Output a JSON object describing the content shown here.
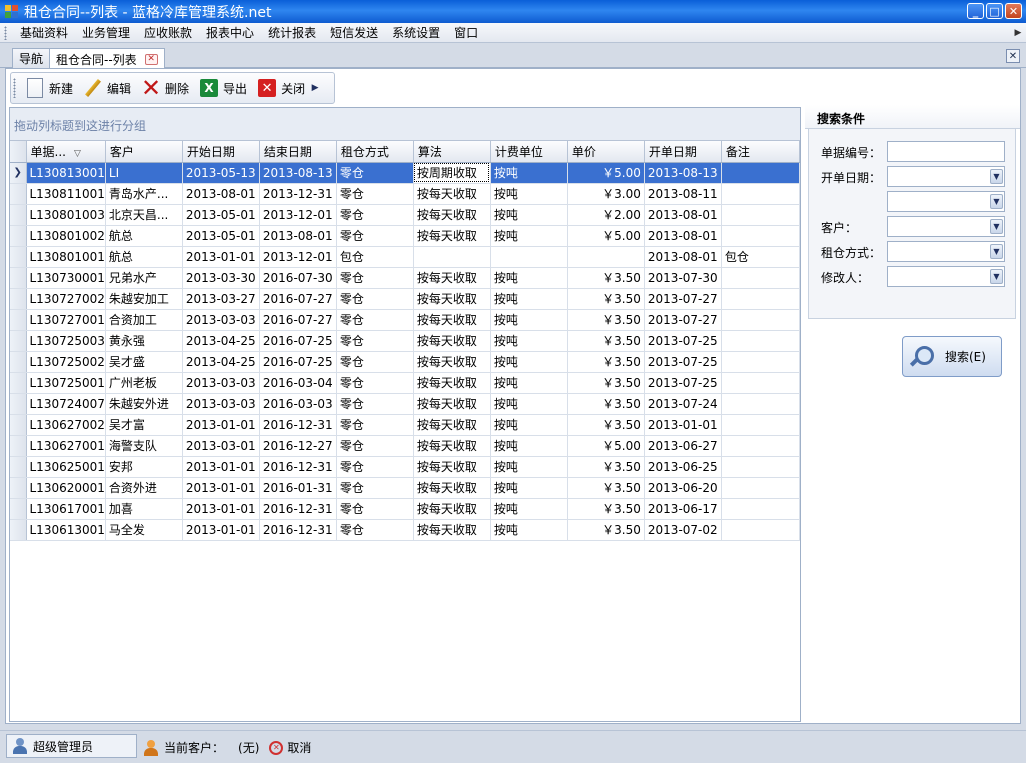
{
  "window": {
    "title": "租仓合同--列表 - 蓝格冷库管理系统.net"
  },
  "menu": [
    "基础资料",
    "业务管理",
    "应收账款",
    "报表中心",
    "统计报表",
    "短信发送",
    "系统设置",
    "窗口"
  ],
  "tabs": [
    {
      "label": "导航"
    },
    {
      "label": "租仓合同--列表"
    }
  ],
  "toolbar": {
    "new": "新建",
    "edit": "编辑",
    "delete": "删除",
    "export": "导出",
    "close": "关闭"
  },
  "grid": {
    "group_hint": "拖动列标题到这进行分组",
    "columns": [
      "单据...",
      "客户",
      "开始日期",
      "结束日期",
      "租仓方式",
      "算法",
      "计费单位",
      "单价",
      "开单日期",
      "备注"
    ],
    "rows": [
      [
        "L130813001",
        "LI",
        "2013-05-13",
        "2013-08-13",
        "零仓",
        "按周期收取",
        "按吨",
        "￥5.00",
        "2013-08-13",
        ""
      ],
      [
        "L130811001",
        "青岛水产...",
        "2013-08-01",
        "2013-12-31",
        "零仓",
        "按每天收取",
        "按吨",
        "￥3.00",
        "2013-08-11",
        ""
      ],
      [
        "L130801003",
        "北京天昌...",
        "2013-05-01",
        "2013-12-01",
        "零仓",
        "按每天收取",
        "按吨",
        "￥2.00",
        "2013-08-01",
        ""
      ],
      [
        "L130801002",
        "航总",
        "2013-05-01",
        "2013-08-01",
        "零仓",
        "按每天收取",
        "按吨",
        "￥5.00",
        "2013-08-01",
        ""
      ],
      [
        "L130801001",
        "航总",
        "2013-01-01",
        "2013-12-01",
        "包仓",
        "",
        "",
        "",
        "2013-08-01",
        "包仓"
      ],
      [
        "L130730001",
        "兄弟水产",
        "2013-03-30",
        "2016-07-30",
        "零仓",
        "按每天收取",
        "按吨",
        "￥3.50",
        "2013-07-30",
        ""
      ],
      [
        "L130727002",
        "朱越安加工",
        "2013-03-27",
        "2016-07-27",
        "零仓",
        "按每天收取",
        "按吨",
        "￥3.50",
        "2013-07-27",
        ""
      ],
      [
        "L130727001",
        "合资加工",
        "2013-03-03",
        "2016-07-27",
        "零仓",
        "按每天收取",
        "按吨",
        "￥3.50",
        "2013-07-27",
        ""
      ],
      [
        "L130725003",
        "黄永强",
        "2013-04-25",
        "2016-07-25",
        "零仓",
        "按每天收取",
        "按吨",
        "￥3.50",
        "2013-07-25",
        ""
      ],
      [
        "L130725002",
        "吴才盛",
        "2013-04-25",
        "2016-07-25",
        "零仓",
        "按每天收取",
        "按吨",
        "￥3.50",
        "2013-07-25",
        ""
      ],
      [
        "L130725001",
        "广州老板",
        "2013-03-03",
        "2016-03-04",
        "零仓",
        "按每天收取",
        "按吨",
        "￥3.50",
        "2013-07-25",
        ""
      ],
      [
        "L130724007",
        "朱越安外进",
        "2013-03-03",
        "2016-03-03",
        "零仓",
        "按每天收取",
        "按吨",
        "￥3.50",
        "2013-07-24",
        ""
      ],
      [
        "L130627002",
        "吴才富",
        "2013-01-01",
        "2016-12-31",
        "零仓",
        "按每天收取",
        "按吨",
        "￥3.50",
        "2013-01-01",
        ""
      ],
      [
        "L130627001",
        "海警支队",
        "2013-03-01",
        "2016-12-27",
        "零仓",
        "按每天收取",
        "按吨",
        "￥5.00",
        "2013-06-27",
        ""
      ],
      [
        "L130625001",
        "安邦",
        "2013-01-01",
        "2016-12-31",
        "零仓",
        "按每天收取",
        "按吨",
        "￥3.50",
        "2013-06-25",
        ""
      ],
      [
        "L130620001",
        "合资外进",
        "2013-01-01",
        "2016-01-31",
        "零仓",
        "按每天收取",
        "按吨",
        "￥3.50",
        "2013-06-20",
        ""
      ],
      [
        "L130617001",
        "加喜",
        "2013-01-01",
        "2016-12-31",
        "零仓",
        "按每天收取",
        "按吨",
        "￥3.50",
        "2013-06-17",
        ""
      ],
      [
        "L130613001",
        "马全发",
        "2013-01-01",
        "2016-12-31",
        "零仓",
        "按每天收取",
        "按吨",
        "￥3.50",
        "2013-07-02",
        ""
      ]
    ]
  },
  "search": {
    "title": "搜索条件",
    "doc_no_label": "单据编号：",
    "open_date_label": "开单日期：",
    "customer_label": "客户：",
    "rent_mode_label": "租仓方式：",
    "modifier_label": "修改人：",
    "button": "搜索(E)"
  },
  "status": {
    "user": "超级管理员",
    "current_customer_label": "当前客户：",
    "current_customer_value": "(无)",
    "cancel": "取消"
  },
  "colors": {
    "title_bar": "#2f86f0",
    "selection": "#3a70d0",
    "group_hint": "#6d82a8"
  }
}
